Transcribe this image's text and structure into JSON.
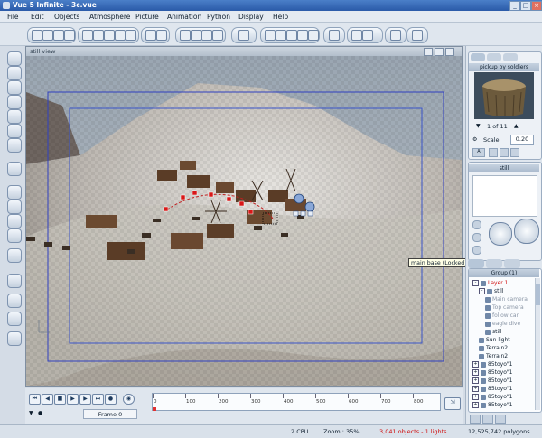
{
  "window": {
    "title": "Vue 5 Infinite - 3c.vue"
  },
  "menu": [
    "File",
    "Edit",
    "Objects",
    "Atmosphere",
    "Picture",
    "Animation",
    "Python",
    "Display",
    "Help"
  ],
  "viewport": {
    "label": "still view"
  },
  "tooltip": "main base (Locked)",
  "timeline": {
    "frame": "Frame 0",
    "ticks": [
      "0",
      "100",
      "200",
      "300",
      "400",
      "500",
      "600",
      "700",
      "800"
    ]
  },
  "status": {
    "cpu": "2 CPU",
    "zoom": "Zoom : 35%",
    "objects": "3,041 objects - 1 lights",
    "polygons": "12,525,742 polygons"
  },
  "colors": {
    "objects_text": "#d01010",
    "accent": "#3a6ab0"
  },
  "panel": {
    "preview_title": "pickup by soldiers",
    "page": "1 of 11",
    "scale_label": "Scale",
    "scale_value": "0.20",
    "camera_title": "still",
    "group_title": "Group (1)",
    "tree": [
      {
        "label": "Layer 1",
        "indent": 0,
        "box": "-",
        "red": true
      },
      {
        "label": "still",
        "indent": 1,
        "box": "-",
        "red": false
      },
      {
        "label": "Main camera",
        "indent": 2,
        "box": "",
        "red": false,
        "dim": true
      },
      {
        "label": "Top camera",
        "indent": 2,
        "box": "",
        "red": false,
        "dim": true
      },
      {
        "label": "follow car",
        "indent": 2,
        "box": "",
        "red": false,
        "dim": true
      },
      {
        "label": "eagle dive",
        "indent": 2,
        "box": "",
        "red": false,
        "dim": true
      },
      {
        "label": "still",
        "indent": 2,
        "box": "",
        "red": false
      },
      {
        "label": "Sun light",
        "indent": 1,
        "box": "",
        "red": false
      },
      {
        "label": "Terrain2",
        "indent": 1,
        "box": "",
        "red": false
      },
      {
        "label": "Terrain2",
        "indent": 1,
        "box": "",
        "red": false
      },
      {
        "label": "85toyo\"1",
        "indent": 0,
        "box": "+",
        "red": false
      },
      {
        "label": "85toyo\"1",
        "indent": 0,
        "box": "+",
        "red": false
      },
      {
        "label": "85toyo\"1",
        "indent": 0,
        "box": "+",
        "red": false
      },
      {
        "label": "85toyo\"1",
        "indent": 0,
        "box": "+",
        "red": false
      },
      {
        "label": "85toyo\"1",
        "indent": 0,
        "box": "+",
        "red": false
      },
      {
        "label": "85toyo\"1",
        "indent": 0,
        "box": "+",
        "red": false
      }
    ]
  }
}
